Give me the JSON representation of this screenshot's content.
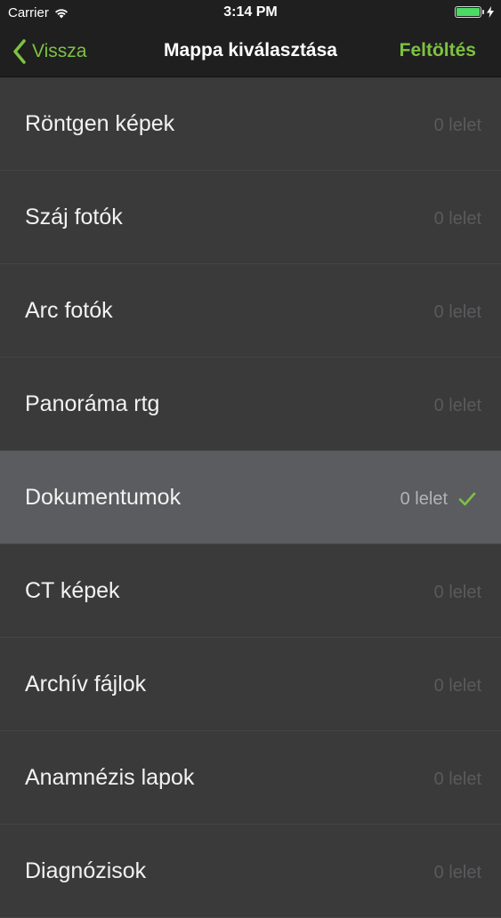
{
  "status_bar": {
    "carrier": "Carrier",
    "time": "3:14 PM",
    "icons": [
      "wifi-icon",
      "battery-icon",
      "charging-bolt-icon"
    ]
  },
  "nav": {
    "back_label": "Vissza",
    "title": "Mappa kiválasztása",
    "action_label": "Feltöltés"
  },
  "colors": {
    "accent": "#7dc242",
    "background": "#3a3a3b",
    "selected_row": "#5b5c5f",
    "nav_background": "#1f1f1f"
  },
  "folders": [
    {
      "name": "Röntgen képek",
      "count": "0 lelet",
      "selected": false
    },
    {
      "name": "Száj fotók",
      "count": "0 lelet",
      "selected": false
    },
    {
      "name": "Arc fotók",
      "count": "0 lelet",
      "selected": false
    },
    {
      "name": "Panoráma rtg",
      "count": "0 lelet",
      "selected": false
    },
    {
      "name": "Dokumentumok",
      "count": "0 lelet",
      "selected": true
    },
    {
      "name": "CT képek",
      "count": "0 lelet",
      "selected": false
    },
    {
      "name": "Archív fájlok",
      "count": "0 lelet",
      "selected": false
    },
    {
      "name": "Anamnézis lapok",
      "count": "0 lelet",
      "selected": false
    },
    {
      "name": "Diagnózisok",
      "count": "0 lelet",
      "selected": false
    }
  ]
}
